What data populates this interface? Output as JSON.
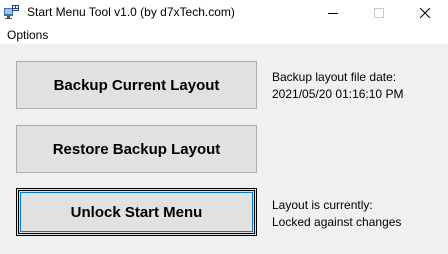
{
  "window": {
    "title": "Start Menu Tool  v1.0 (by d7xTech.com)",
    "icon": "app-window-icon"
  },
  "menu": {
    "options_label": "Options"
  },
  "buttons": {
    "backup_label": "Backup Current Layout",
    "restore_label": "Restore Backup Layout",
    "unlock_label": "Unlock Start Menu"
  },
  "info": {
    "backup_heading": "Backup layout file date:",
    "backup_value": "2021/05/20 01:16:10 PM",
    "layout_heading": "Layout is currently:",
    "layout_value": "Locked against changes"
  },
  "colors": {
    "window_bg": "#f0f0f0",
    "button_bg": "#e1e1e1",
    "button_border": "#adadad",
    "focus_blue": "#0078d7"
  }
}
